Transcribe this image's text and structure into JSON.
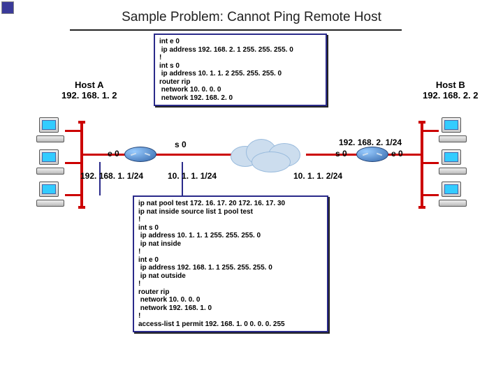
{
  "title": "Sample Problem: Cannot Ping Remote Host",
  "hostA": {
    "name": "Host A",
    "ip": "192. 168. 1. 2"
  },
  "hostB": {
    "name": "Host B",
    "ip": "192. 168. 2. 2"
  },
  "leftRouter": {
    "e0_label": "e 0",
    "s0_label": "s 0",
    "e0_net": "192. 168. 1. 1/24",
    "s0_net": "10. 1. 1. 1/24"
  },
  "rightRouter": {
    "e0_label": "e 0",
    "s0_label": "s 0",
    "e0_net": "192. 168. 2. 1/24",
    "s0_net": "10. 1. 1. 2/24"
  },
  "configTop": "int e 0\n ip address 192. 168. 2. 1 255. 255. 255. 0\n!\nint s 0\n ip address 10. 1. 1. 2 255. 255. 255. 0\nrouter rip\n network 10. 0. 0. 0\n network 192. 168. 2. 0",
  "configBottom": "ip nat pool test 172. 16. 17. 20 172. 16. 17. 30\nip nat inside source list 1 pool test\n!\nint s 0\n ip address 10. 1. 1. 1 255. 255. 255. 0\n ip nat inside\n!\nint e 0\n ip address 192. 168. 1. 1 255. 255. 255. 0\n ip nat outside\n!\nrouter rip\n network 10. 0. 0. 0\n network 192. 168. 1. 0\n!\naccess-list 1 permit 192. 168. 1. 0 0. 0. 0. 255"
}
